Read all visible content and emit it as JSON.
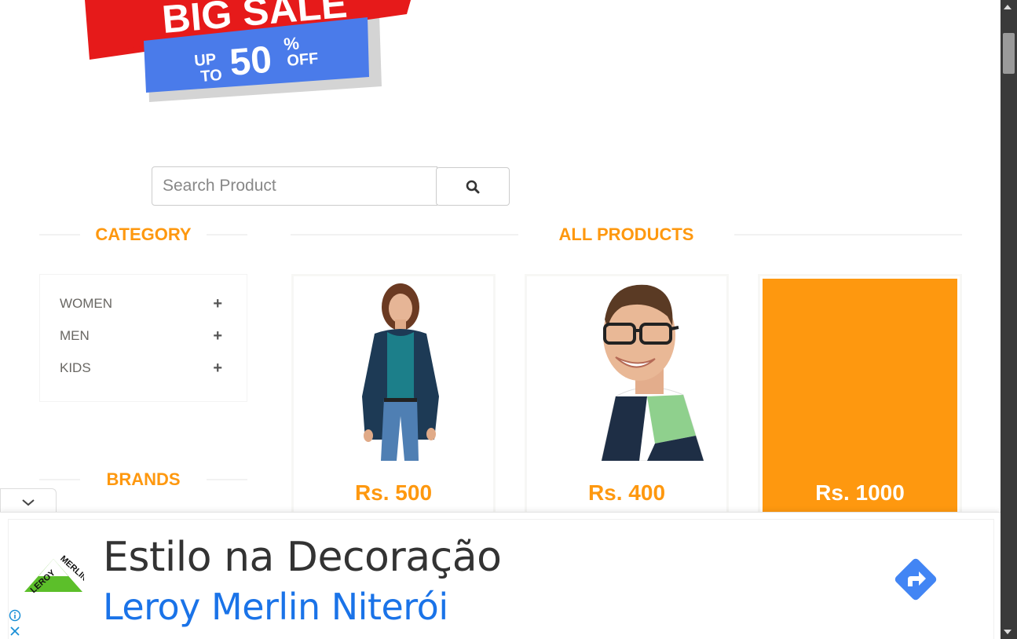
{
  "banner": {
    "headline": "BIG SALE",
    "up_to": [
      "UP",
      "TO"
    ],
    "percent": "50",
    "percent_sign": "%",
    "off": "OFF"
  },
  "search": {
    "placeholder": "Search Product",
    "button_icon": "search-icon"
  },
  "category": {
    "title": "CATEGORY",
    "items": [
      {
        "label": "WOMEN",
        "icon": "plus-icon"
      },
      {
        "label": "MEN",
        "icon": "plus-icon"
      },
      {
        "label": "KIDS",
        "icon": "plus-icon"
      }
    ]
  },
  "brands": {
    "title": "BRANDS"
  },
  "products": {
    "title": "ALL PRODUCTS",
    "items": [
      {
        "price": "Rs. 500",
        "image": "woman-in-cardigan"
      },
      {
        "price": "Rs. 400",
        "image": "man-with-glasses"
      },
      {
        "price": "Rs. 1000",
        "image": "",
        "hover": true
      }
    ]
  },
  "ad": {
    "headline": "Estilo na Decoração",
    "subline": "Leroy Merlin Niterói",
    "logo_text": "LEROY MERLIN",
    "cta_icon": "directions-icon",
    "info_icon": "info-icon",
    "close_icon": "close-icon",
    "toggle_icon": "chevron-down-icon"
  },
  "colors": {
    "accent": "#fe980f",
    "sale_red": "#e61a1a",
    "sale_blue": "#4a7bea",
    "ad_blue": "#1a73e8",
    "logo_green": "#5cbf2a"
  }
}
